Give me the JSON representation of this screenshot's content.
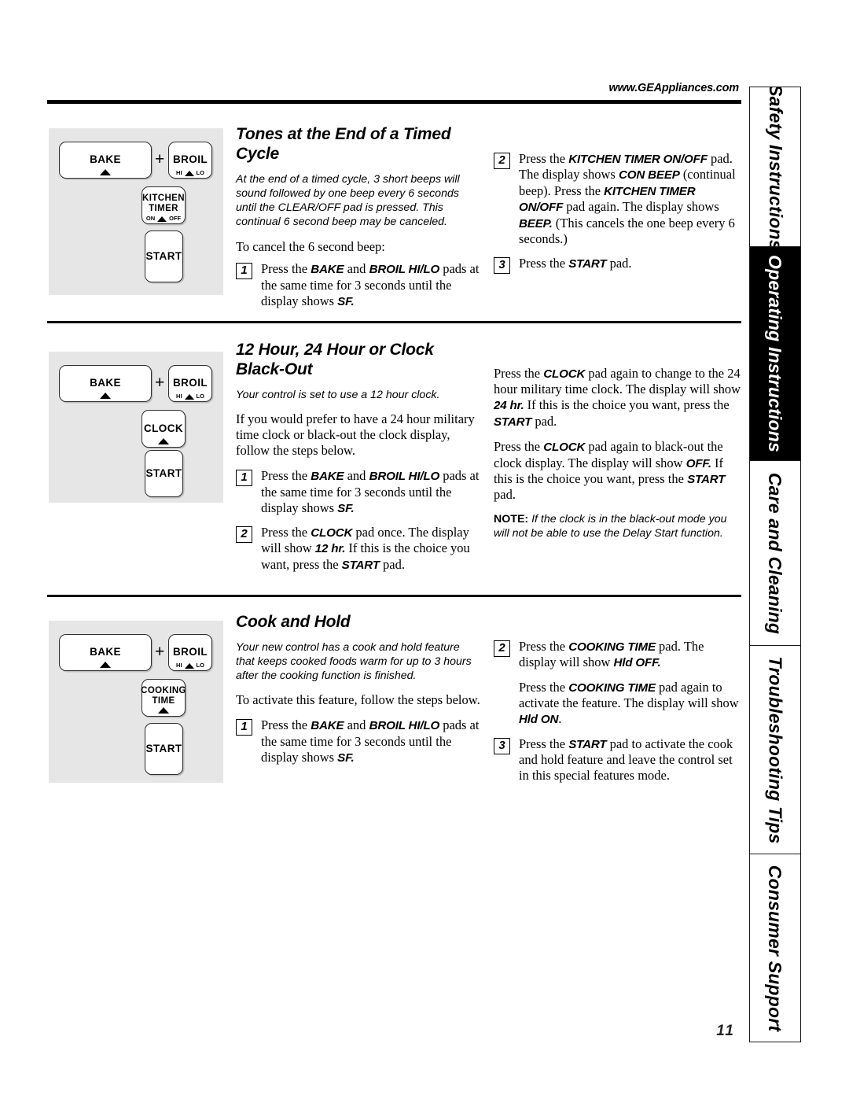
{
  "header": {
    "url": "www.GEAppliances.com"
  },
  "page_number": "11",
  "sidetabs": [
    {
      "label": "Safety Instructions",
      "inverted": false
    },
    {
      "label": "Operating Instructions",
      "inverted": true
    },
    {
      "label": "Care and Cleaning",
      "inverted": false
    },
    {
      "label": "Troubleshooting Tips",
      "inverted": false
    },
    {
      "label": "Consumer Support",
      "inverted": false
    }
  ],
  "pads": {
    "bake": "BAKE",
    "broil": "BROIL",
    "broil_hi": "HI",
    "broil_lo": "LO",
    "plus": "+",
    "kitchen_timer_l1": "KITCHEN",
    "kitchen_timer_l2": "TIMER",
    "kitchen_on": "ON",
    "kitchen_off": "OFF",
    "clock": "CLOCK",
    "cooking_time_l1": "COOKING",
    "cooking_time_l2": "TIME",
    "start": "START"
  },
  "sections": [
    {
      "title": "Tones at the End of a Timed Cycle",
      "intro": "At the end of a timed cycle, 3 short beeps will sound followed by one beep every 6 seconds until the CLEAR/OFF pad is pressed. This continual 6 second beep may be canceled.",
      "lead": "To cancel the 6 second beep:",
      "step1_num": "1",
      "step2_num": "2",
      "step3_num": "3",
      "step1_a": "Press the ",
      "step1_kw1": "BAKE",
      "step1_b": " and ",
      "step1_kw2": "BROIL HI/LO",
      "step1_c": " pads at the same time for 3 seconds until the display shows ",
      "step1_kw3": "SF.",
      "step2_a": "Press the ",
      "step2_kw1": "KITCHEN TIMER ON/OFF",
      "step2_b": " pad. The display shows ",
      "step2_kw2": "CON BEEP",
      "step2_c": " (continual beep). Press the ",
      "step2_kw3": "KITCHEN TIMER ON/OFF",
      "step2_d": " pad again. The display shows ",
      "step2_kw4": "BEEP.",
      "step2_e": " (This cancels the one beep every 6 seconds.)",
      "step3_a": "Press the ",
      "step3_kw1": "START",
      "step3_b": " pad."
    },
    {
      "title": "12 Hour, 24 Hour or Clock Black-Out",
      "intro": "Your control is set to use a 12 hour clock.",
      "lead": "If you would prefer to have a 24 hour military time clock or black-out the clock display, follow the steps below.",
      "step1_num": "1",
      "step2_num": "2",
      "step1_a": "Press the ",
      "step1_kw1": "BAKE",
      "step1_b": " and ",
      "step1_kw2": "BROIL HI/LO",
      "step1_c": " pads at the same time for 3 seconds until the display shows ",
      "step1_kw3": "SF.",
      "step2_a": "Press the ",
      "step2_kw1": "CLOCK",
      "step2_b": " pad once. The display will show ",
      "step2_kw2": "12 hr.",
      "step2_c": "  If this is the choice you want, press the ",
      "step2_kw3": "START",
      "step2_d": " pad.",
      "right1_a": "Press the ",
      "right1_kw1": "CLOCK",
      "right1_b": " pad again to change to the 24 hour military time clock. The display will show ",
      "right1_kw2": "24 hr.",
      "right1_c": "  If this is the choice you want, press the ",
      "right1_kw3": "START",
      "right1_d": " pad.",
      "right2_a": "Press the ",
      "right2_kw1": "CLOCK",
      "right2_b": " pad again to black-out the clock display. The display will show ",
      "right2_kw2": "OFF.",
      "right2_c": "  If this is the choice you want, press the ",
      "right2_kw3": "START",
      "right2_d": " pad.",
      "note_label": "NOTE:",
      "note_text": " If the clock is in the black-out mode you will not be able to use the Delay Start function."
    },
    {
      "title": "Cook and Hold",
      "intro": "Your new control has a cook and hold feature that keeps cooked foods warm for up to 3 hours after the cooking function is finished.",
      "lead": "To activate this feature, follow the steps below.",
      "step1_num": "1",
      "step2_num": "2",
      "step3_num": "3",
      "step1_a": "Press the ",
      "step1_kw1": "BAKE",
      "step1_b": " and ",
      "step1_kw2": "BROIL HI/LO",
      "step1_c": " pads at the same time for 3 seconds until the display shows ",
      "step1_kw3": "SF.",
      "step2_a": "Press the ",
      "step2_kw1": "COOKING TIME",
      "step2_b": " pad. The display will show ",
      "step2_kw2": "Hld OFF.",
      "step2_cont_a": "Press the ",
      "step2_cont_kw1": "COOKING TIME",
      "step2_cont_b": " pad again to activate the feature. The display will show ",
      "step2_cont_kw2": "Hld ON",
      "step2_cont_c": ".",
      "step3_a": "Press the ",
      "step3_kw1": "START",
      "step3_b": " pad to activate the cook and hold feature and leave the control set in this special features mode."
    }
  ]
}
